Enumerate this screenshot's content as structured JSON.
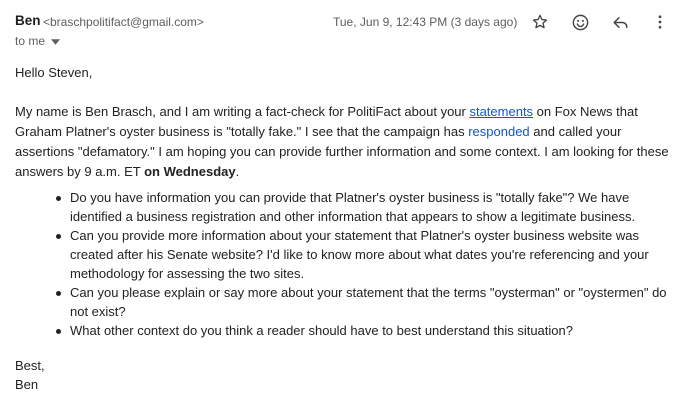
{
  "header": {
    "sender_name": "Ben",
    "sender_email": "<braschpolitifact@gmail.com>",
    "date": "Tue, Jun 9, 12:43 PM (3 days ago)",
    "icons": [
      "star-icon",
      "emoji-icon",
      "reply-icon",
      "more-vert-icon"
    ]
  },
  "recipients": {
    "label": "to me"
  },
  "message": {
    "greeting": "Hello Steven,",
    "p1": {
      "t1": "My name is Ben Brasch, and I am writing a fact-check for PolitiFact about your ",
      "link1": "statements",
      "t2": " on Fox News that Graham Platner's oyster business is \"totally fake.\" I see that the campaign has ",
      "link2": "responded",
      "t3": " and called your assertions \"defamatory.\" I am hoping you can provide further information and some context. I am looking for these answers by 9 a.m. ET ",
      "bold": "on Wednesday",
      "t4": "."
    },
    "questions": [
      "Do you have information you can provide that Platner's oyster business is \"totally fake\"? We have identified a business registration and other information that appears to show a legitimate business.",
      "Can you provide more information about your statement that Platner's oyster business website was created after his Senate website? I'd like to know more about what dates you're referencing and your methodology for assessing the two sites.",
      "Can you please explain or say more about your statement that the terms \"oysterman\" or \"oystermen\" do not exist?",
      "What other context do you think a reader should have to best understand this situation?"
    ],
    "signoff": "Best,",
    "signature": "Ben"
  },
  "colors": {
    "link": "#1155cc",
    "text": "#222222",
    "meta": "#5e5e5e"
  }
}
